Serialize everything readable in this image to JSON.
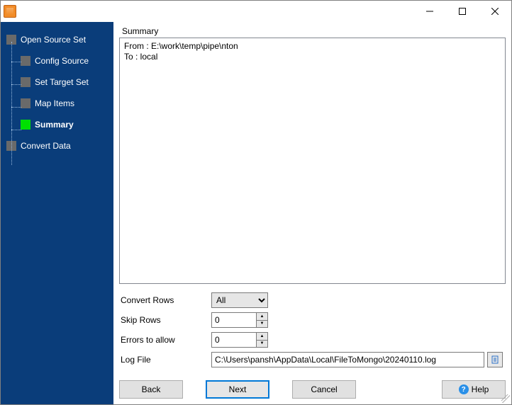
{
  "titlebar": {
    "title": ""
  },
  "sidebar": {
    "items": [
      {
        "label": "Open Source Set",
        "level": "root"
      },
      {
        "label": "Config Source",
        "level": "child"
      },
      {
        "label": "Set Target Set",
        "level": "child"
      },
      {
        "label": "Map Items",
        "level": "child"
      },
      {
        "label": "Summary",
        "level": "child",
        "active": true
      },
      {
        "label": "Convert Data",
        "level": "last"
      }
    ]
  },
  "summary": {
    "heading": "Summary",
    "text": "From : E:\\work\\temp\\pipe\\nton\nTo : local"
  },
  "form": {
    "convert_rows": {
      "label": "Convert Rows",
      "value": "All",
      "options": [
        "All"
      ]
    },
    "skip_rows": {
      "label": "Skip Rows",
      "value": "0"
    },
    "errors_to_allow": {
      "label": "Errors to allow",
      "value": "0"
    },
    "log_file": {
      "label": "Log File",
      "value": "C:\\Users\\pansh\\AppData\\Local\\FileToMongo\\20240110.log"
    }
  },
  "buttons": {
    "back": "Back",
    "next": "Next",
    "cancel": "Cancel",
    "help": "Help"
  }
}
